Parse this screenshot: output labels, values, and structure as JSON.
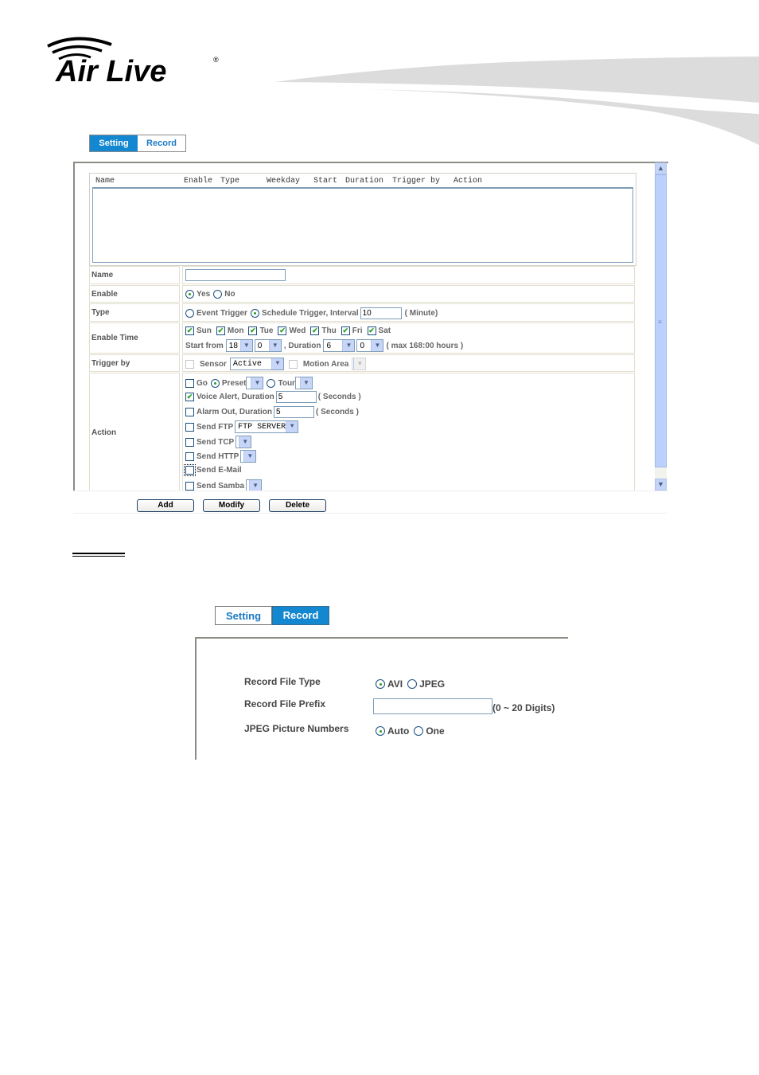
{
  "header": {
    "logo_text": "Air Live",
    "logo_mark": "®"
  },
  "tabs_top": [
    {
      "label": "Setting",
      "active": true
    },
    {
      "label": "Record",
      "active": false
    }
  ],
  "event_list": {
    "columns": [
      "Name",
      "Enable",
      "Type",
      "Weekday",
      "Start",
      "Duration",
      "Trigger by",
      "Action"
    ],
    "rows": []
  },
  "form": {
    "name": {
      "label": "Name",
      "value": ""
    },
    "enable": {
      "label": "Enable",
      "options": [
        "Yes",
        "No"
      ],
      "selected": "Yes"
    },
    "type": {
      "label": "Type",
      "options": [
        "Event Trigger",
        "Schedule Trigger, Interval"
      ],
      "selected": "Schedule Trigger, Interval",
      "interval_value": "10",
      "interval_unit": "( Minute)"
    },
    "enable_time": {
      "label": "Enable Time",
      "days": [
        {
          "label": "Sun",
          "checked": true
        },
        {
          "label": "Mon",
          "checked": true
        },
        {
          "label": "Tue",
          "checked": true
        },
        {
          "label": "Wed",
          "checked": true
        },
        {
          "label": "Thu",
          "checked": true
        },
        {
          "label": "Fri",
          "checked": true
        },
        {
          "label": "Sat",
          "checked": true
        }
      ],
      "start_from_label": "Start from",
      "start_hour": "18",
      "start_min": "0",
      "duration_label": ", Duration",
      "duration_hour": "6",
      "duration_min": "0",
      "max_note": "( max 168:00 hours )"
    },
    "trigger_by": {
      "label": "Trigger by",
      "sensor_label": "Sensor",
      "sensor_checked": false,
      "sensor_value": "Active",
      "motion_label": "Motion Area",
      "motion_checked": false,
      "motion_value": ""
    },
    "action": {
      "label": "Action",
      "go_label": "Go",
      "go_checked": false,
      "preset_label": "Preset",
      "preset_selected": true,
      "preset_value": "",
      "tour_label": "Tour",
      "tour_value": "",
      "voice_label": "Voice Alert, Duration",
      "voice_checked": true,
      "voice_value": "5",
      "voice_unit": "( Seconds )",
      "alarm_label": "Alarm Out, Duration",
      "alarm_checked": false,
      "alarm_value": "5",
      "alarm_unit": "( Seconds )",
      "ftp_label": "Send FTP",
      "ftp_checked": false,
      "ftp_value": "FTP SERVER",
      "tcp_label": "Send TCP",
      "tcp_checked": false,
      "tcp_value": "",
      "http_label": "Send HTTP",
      "http_checked": false,
      "http_value": "",
      "email_label": "Send E-Mail",
      "email_checked": false,
      "samba_label": "Send Samba",
      "samba_checked": false,
      "samba_value": ""
    }
  },
  "buttons": {
    "add": "Add",
    "modify": "Modify",
    "delete": "Delete"
  },
  "tabs_record": [
    {
      "label": "Setting",
      "active": false
    },
    {
      "label": "Record",
      "active": true
    }
  ],
  "record": {
    "file_type": {
      "label": "Record File Type",
      "options": [
        "AVI",
        "JPEG"
      ],
      "selected": "AVI"
    },
    "prefix": {
      "label": "Record File Prefix",
      "value": "",
      "hint": "(0 ~ 20 Digits)"
    },
    "jpeg_numbers": {
      "label": "JPEG Picture Numbers",
      "options": [
        "Auto",
        "One"
      ],
      "selected": "Auto"
    }
  },
  "colors": {
    "accent": "#1387cf",
    "check_green": "#21a121",
    "scroll_blue": "#bbd0fa"
  }
}
